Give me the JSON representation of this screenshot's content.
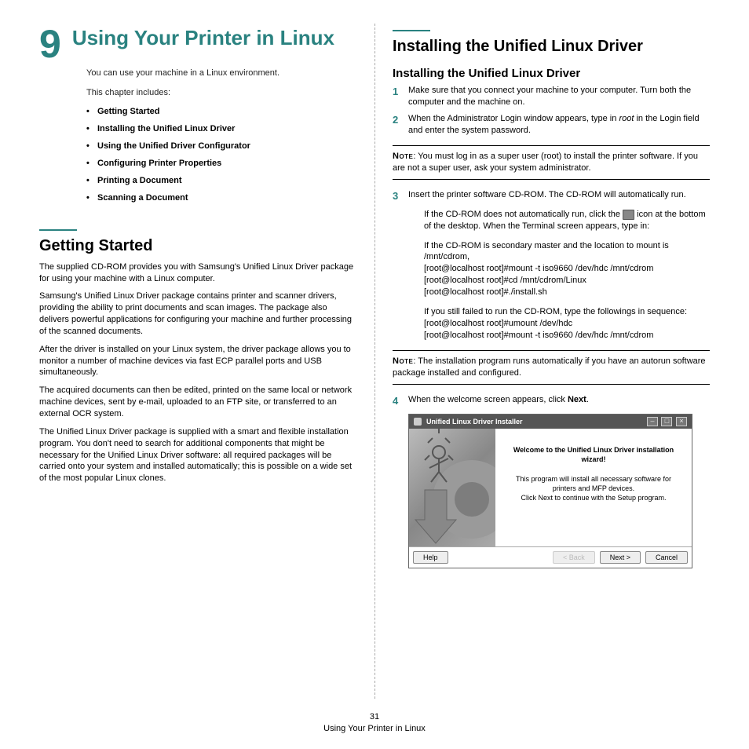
{
  "chapter": {
    "num": "9",
    "title": "Using Your Printer in Linux"
  },
  "intro": "You can use your machine in a Linux environment.",
  "includes_lead": "This chapter includes:",
  "toc": [
    "Getting Started",
    "Installing the Unified Linux Driver",
    "Using the Unified Driver Configurator",
    "Configuring Printer Properties",
    "Printing a Document",
    "Scanning a Document"
  ],
  "getting_started": {
    "heading": "Getting Started",
    "p1": "The supplied CD-ROM provides you with Samsung's Unified Linux Driver package for using your machine with a Linux computer.",
    "p2": "Samsung's Unified Linux Driver package contains printer and scanner drivers, providing the ability to print documents and scan images. The package also delivers powerful applications for configuring your machine and further processing of the scanned documents.",
    "p3": "After the driver is installed on your Linux system, the driver package allows you to monitor a number of machine devices via fast ECP parallel ports and USB simultaneously.",
    "p4": "The acquired documents can then be edited, printed on the same local or network machine devices, sent by e-mail, uploaded to an FTP site, or transferred to an external OCR system.",
    "p5": "The Unified Linux Driver package is supplied with a smart and flexible installation program. You don't need to search for additional components that might be necessary for the Unified Linux Driver software: all required packages will be carried onto your system and installed automatically; this is possible on a wide set of the most popular Linux clones."
  },
  "install": {
    "heading": "Installing the Unified Linux Driver",
    "sub": "Installing the Unified Linux Driver",
    "step1": "Make sure that you connect your machine to your computer. Turn both the computer and the machine on.",
    "step2a": "When the Administrator Login window appears, type in ",
    "step2_root": "root",
    "step2b": " in the Login field and enter the system password.",
    "note1_label": "Note",
    "note1": ": You must log in as a super user (root) to install the printer software. If you are not a super user, ask your system administrator.",
    "step3": "Insert the printer software CD-ROM. The CD-ROM will automatically run.",
    "sub3a_a": "If the CD-ROM does not automatically run, click the ",
    "sub3a_b": " icon at the bottom of the desktop. When the Terminal screen appears, type in:",
    "sub3b": "If the CD-ROM is secondary master and the location to mount is /mnt/cdrom,",
    "cmd1": "[root@localhost root]#mount -t iso9660 /dev/hdc /mnt/cdrom",
    "cmd2": "[root@localhost root]#cd /mnt/cdrom/Linux",
    "cmd3": "[root@localhost root]#./install.sh",
    "sub3c": "If you still failed to run the CD-ROM, type the followings in sequence:",
    "cmd4": "[root@localhost root]#umount /dev/hdc",
    "cmd5": "[root@localhost root]#mount -t iso9660 /dev/hdc /mnt/cdrom",
    "note2_label": "Note",
    "note2": ": The installation program runs automatically if you have an autorun software package installed and configured.",
    "step4a": "When the welcome screen appears, click ",
    "step4_next": "Next",
    "step4b": "."
  },
  "wizard": {
    "title": "Unified Linux Driver Installer",
    "welcome": "Welcome to the Unified Linux Driver installation wizard!",
    "line1": "This program will install all necessary software for printers and MFP devices.",
    "line2": "Click Next to continue with the Setup program.",
    "help": "Help",
    "back": "< Back",
    "next": "Next >",
    "cancel": "Cancel"
  },
  "footer": {
    "page": "31",
    "label": "Using Your Printer in Linux"
  }
}
